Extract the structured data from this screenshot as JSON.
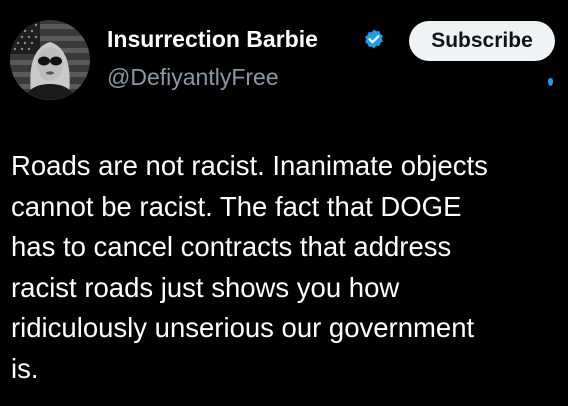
{
  "author": {
    "name": "Insurrection Barbie",
    "handle": "@DefiyantlyFree",
    "verified_color": "#1d9bf0"
  },
  "header": {
    "subscribe_label": "Subscribe"
  },
  "post": {
    "lines": [
      "Roads are not racist. Inanimate objects",
      "cannot be racist. The fact that DOGE",
      "has to cancel contracts that address",
      "racist roads just shows you how",
      "ridiculously unserious our government",
      "is."
    ]
  },
  "colors": {
    "background": "#000000",
    "text": "#ffffff",
    "secondary_text": "#8b98a5",
    "button_bg": "#eff3f4",
    "accent": "#1d9bf0"
  }
}
